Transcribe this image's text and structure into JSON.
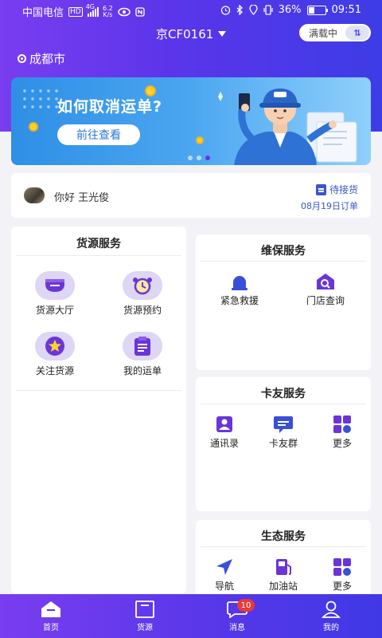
{
  "status_bar": {
    "carrier": "中国电信",
    "hd": "HD",
    "net_type": "4G",
    "speed_value": "6.2",
    "speed_unit": "K/s",
    "battery": "36%",
    "time": "09:51"
  },
  "header": {
    "plate": "京CF0161",
    "load_status": "满载中",
    "city": "成都市"
  },
  "banner": {
    "title": "如何取消运单?",
    "button": "前往查看",
    "slide_count": 3,
    "active_slide": 3
  },
  "greeting": {
    "text": "你好 王光俊",
    "pending_label": "待接货",
    "pending_date": "08月19日订单"
  },
  "cargo_service": {
    "title": "货源服务",
    "items": [
      {
        "label": "货源大厅",
        "icon": "cargo-hall-icon"
      },
      {
        "label": "货源预约",
        "icon": "alarm-clock-icon"
      },
      {
        "label": "关注货源",
        "icon": "star-icon"
      },
      {
        "label": "我的运单",
        "icon": "waybill-icon"
      }
    ]
  },
  "maintenance_service": {
    "title": "维保服务",
    "items": [
      {
        "label": "紧急救援",
        "icon": "emergency-icon"
      },
      {
        "label": "门店查询",
        "icon": "store-search-icon"
      }
    ]
  },
  "trucker_service": {
    "title": "卡友服务",
    "items": [
      {
        "label": "通讯录",
        "icon": "contacts-icon"
      },
      {
        "label": "卡友群",
        "icon": "group-chat-icon"
      },
      {
        "label": "更多",
        "icon": "more-grid-icon"
      }
    ]
  },
  "eco_service": {
    "title": "生态服务",
    "items": [
      {
        "label": "导航",
        "icon": "navigation-icon"
      },
      {
        "label": "加油站",
        "icon": "gas-station-icon"
      },
      {
        "label": "更多",
        "icon": "more-grid-icon"
      }
    ]
  },
  "tabbar": {
    "items": [
      {
        "label": "首页",
        "icon": "home-icon"
      },
      {
        "label": "货源",
        "icon": "cargo-icon"
      },
      {
        "label": "消息",
        "icon": "message-icon",
        "badge": "10"
      },
      {
        "label": "我的",
        "icon": "profile-icon"
      }
    ]
  },
  "colors": {
    "brand_purple": "#6a3bee",
    "brand_blue": "#3d3ce6",
    "icon_purple": "#6a35d8",
    "badge_red": "#e83a3a"
  }
}
